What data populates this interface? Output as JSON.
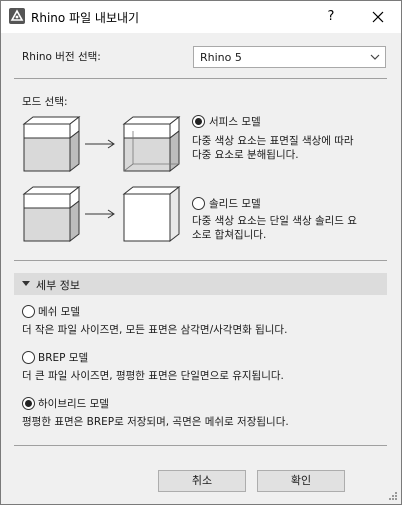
{
  "window": {
    "title": "Rhino 파일 내보내기",
    "help_label": "?"
  },
  "version": {
    "label": "Rhino 버전 선택:",
    "selected": "Rhino 5"
  },
  "mode": {
    "label": "모드 선택:",
    "options": [
      {
        "label": "서피스 모델",
        "selected": true,
        "description_lines": [
          "다중 색상 요소는 표면질 색상에 따라",
          "다중 요소로 분해됩니다."
        ]
      },
      {
        "label": "솔리드 모델",
        "selected": false,
        "description_lines": [
          "다중 색상 요소는 단일 색상 솔리드 요",
          "소로 합쳐집니다."
        ]
      }
    ]
  },
  "details": {
    "title": "세부 정보",
    "options": [
      {
        "label": "메쉬 모델",
        "selected": false,
        "description": "더 작은 파일 사이즈면, 모든 표면은 삼각면/사각면화 됩니다."
      },
      {
        "label": "BREP 모델",
        "selected": false,
        "description": "더 큰 파일 사이즈면, 평평한 표면은 단일면으로 유지됩니다."
      },
      {
        "label": "하이브리드 모델",
        "selected": true,
        "description": "평평한 표면은 BREP로 저장되며, 곡면은 메쉬로 저장됩니다."
      }
    ]
  },
  "buttons": {
    "cancel": "취소",
    "ok": "확인"
  }
}
